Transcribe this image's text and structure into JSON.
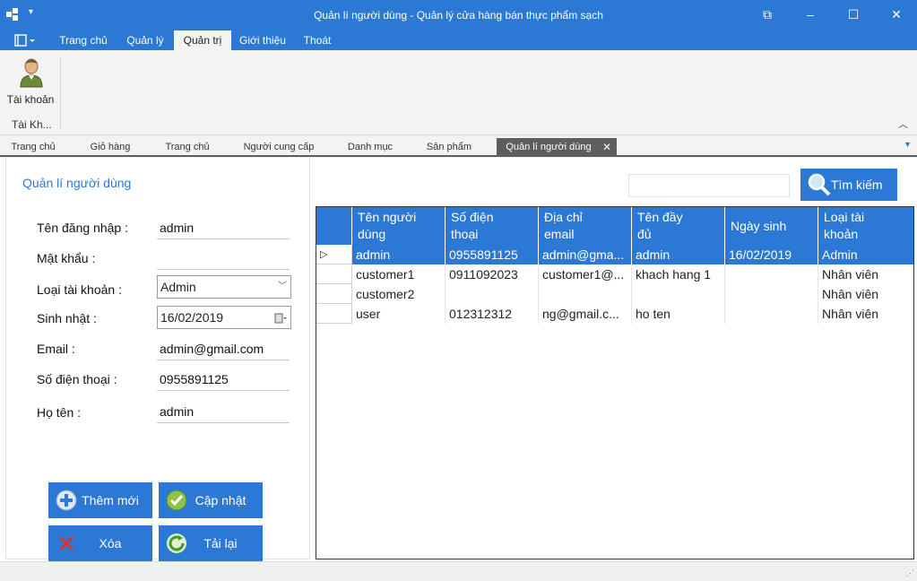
{
  "window": {
    "title": "Quản lí người dùng - Quản lý cửa hàng bán thực phẩm sạch"
  },
  "ribbon": {
    "tabs": [
      "Trang chủ",
      "Quản lý",
      "Quản trị",
      "Giới thiệu",
      "Thoát"
    ],
    "active_tab": "Quản trị",
    "account_button": "Tài khoản",
    "group_label": "Tài Kh..."
  },
  "doc_tabs": [
    "Trang chủ",
    "Giỏ hàng",
    "Trang chủ",
    "Người cung cấp",
    "Danh mục",
    "Sản phẩm",
    "Quản lí người dùng"
  ],
  "form": {
    "title": "Quản lí người dùng",
    "labels": {
      "username": "Tên đăng nhập :",
      "password": "Mật khẩu :",
      "account_type": "Loại tài khoản :",
      "birthday": "Sinh nhật :",
      "email": "Email :",
      "phone": "Số điện thoại :",
      "fullname": "Họ tên :"
    },
    "values": {
      "username": "admin",
      "password": "",
      "account_type": "Admin",
      "birthday": "16/02/2019",
      "email": "admin@gmail.com",
      "phone": "0955891125",
      "fullname": "admin"
    },
    "buttons": {
      "add": "Thêm mới",
      "update": "Cập nhật",
      "delete": "Xóa",
      "reload": "Tải lại"
    }
  },
  "search": {
    "value": "",
    "button": "Tìm kiếm"
  },
  "grid": {
    "headers": [
      [
        "Tên người",
        "dùng"
      ],
      [
        "Số điện",
        "thoại"
      ],
      [
        "Địa chỉ",
        "email"
      ],
      [
        "Tên đầy",
        "đủ"
      ],
      [
        "Ngày sinh",
        ""
      ],
      [
        "Loại tài",
        "khoản"
      ]
    ],
    "rows": [
      [
        "admin",
        "0955891125",
        "admin@gma...",
        "admin",
        "16/02/2019",
        "Admin"
      ],
      [
        "customer1",
        "0911092023",
        "customer1@...",
        "khach hang 1",
        "",
        "Nhân viên"
      ],
      [
        "customer2",
        "",
        "",
        "",
        "",
        "Nhân viên"
      ],
      [
        "user",
        "012312312",
        "ng@gmail.c...",
        "ho ten",
        "",
        "Nhân viên"
      ]
    ]
  },
  "colors": {
    "accent": "#2b79d4",
    "tab_dark": "#5e5e5e"
  }
}
